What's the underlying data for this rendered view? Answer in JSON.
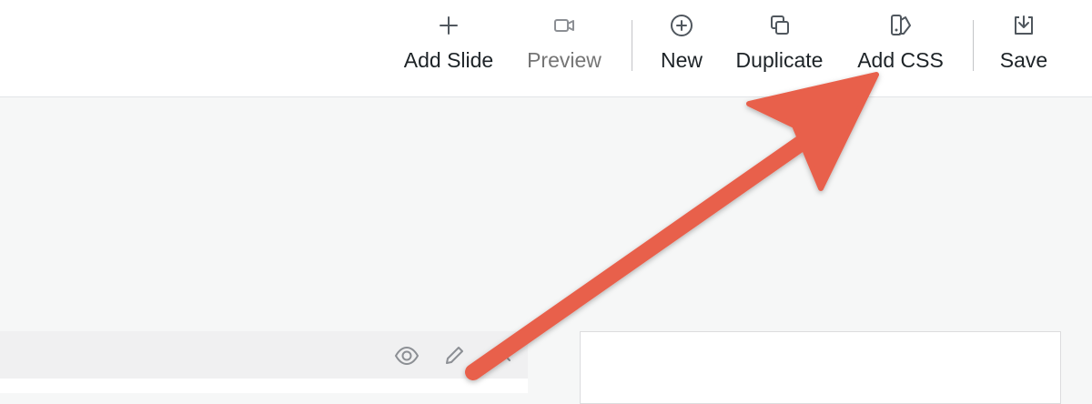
{
  "toolbar": {
    "add_slide": {
      "label": "Add Slide",
      "icon": "plus-icon"
    },
    "preview": {
      "label": "Preview",
      "icon": "video-camera-icon"
    },
    "new": {
      "label": "New",
      "icon": "plus-circle-icon"
    },
    "duplicate": {
      "label": "Duplicate",
      "icon": "copy-icon"
    },
    "add_css": {
      "label": "Add CSS",
      "icon": "css-style-icon"
    },
    "save": {
      "label": "Save",
      "icon": "download-tray-icon"
    }
  },
  "panel": {
    "icons": [
      "eye-icon",
      "pencil-icon",
      "chevron-left-icon"
    ]
  },
  "colors": {
    "toolbar_bg": "#ffffff",
    "canvas_bg": "#f6f7f7",
    "arrow": "#e8604c",
    "text": "#1d2327",
    "muted_text": "#757575"
  }
}
